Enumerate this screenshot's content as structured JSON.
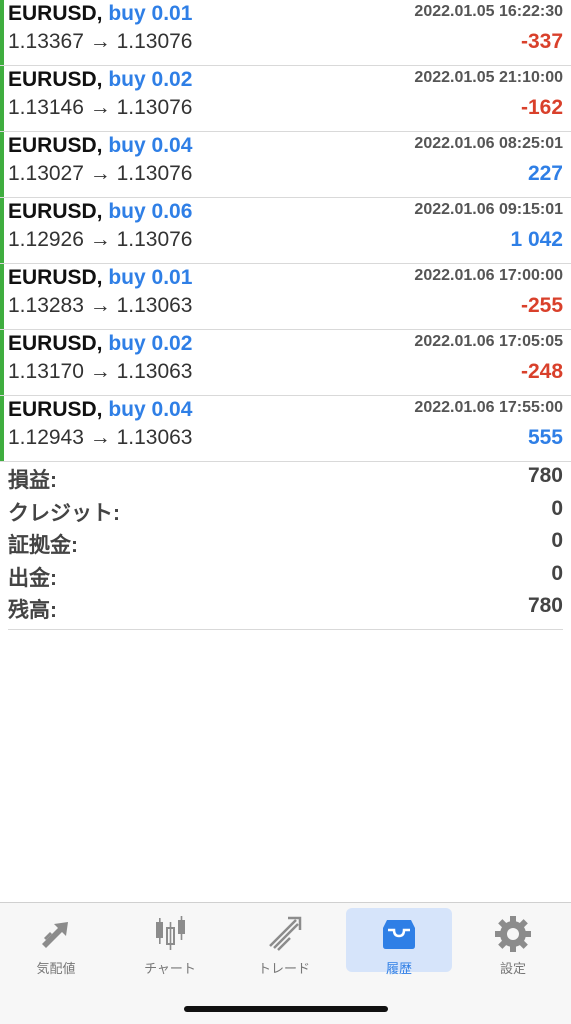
{
  "deals": [
    {
      "symbol": "EURUSD,",
      "type": "buy 0.01",
      "time": "2022.01.05 16:22:30",
      "prices": "1.13367 → 1.13076",
      "profit": "-337",
      "sign": "neg"
    },
    {
      "symbol": "EURUSD,",
      "type": "buy 0.02",
      "time": "2022.01.05 21:10:00",
      "prices": "1.13146 → 1.13076",
      "profit": "-162",
      "sign": "neg"
    },
    {
      "symbol": "EURUSD,",
      "type": "buy 0.04",
      "time": "2022.01.06 08:25:01",
      "prices": "1.13027 → 1.13076",
      "profit": "227",
      "sign": "pos"
    },
    {
      "symbol": "EURUSD,",
      "type": "buy 0.06",
      "time": "2022.01.06 09:15:01",
      "prices": "1.12926 → 1.13076",
      "profit": "1 042",
      "sign": "pos"
    },
    {
      "symbol": "EURUSD,",
      "type": "buy 0.01",
      "time": "2022.01.06 17:00:00",
      "prices": "1.13283 → 1.13063",
      "profit": "-255",
      "sign": "neg"
    },
    {
      "symbol": "EURUSD,",
      "type": "buy 0.02",
      "time": "2022.01.06 17:05:05",
      "prices": "1.13170 → 1.13063",
      "profit": "-248",
      "sign": "neg"
    },
    {
      "symbol": "EURUSD,",
      "type": "buy 0.04",
      "time": "2022.01.06 17:55:00",
      "prices": "1.12943 → 1.13063",
      "profit": "555",
      "sign": "pos"
    }
  ],
  "summary": {
    "profit_label": "損益:",
    "profit_value": "780",
    "credit_label": "クレジット:",
    "credit_value": "0",
    "margin_label": "証拠金:",
    "margin_value": "0",
    "withdrawal_label": "出金:",
    "withdrawal_value": "0",
    "balance_label": "残高:",
    "balance_value": "780"
  },
  "tabs": {
    "quotes": "気配値",
    "chart": "チャート",
    "trade": "トレード",
    "history": "履歴",
    "settings": "設定"
  },
  "colors": {
    "accent": "#2f7fe6",
    "loss": "#d9402b",
    "buy_bar": "#3fae3f",
    "active_tab_bg": "#d6e4fa"
  },
  "icons": {
    "quotes": "diagonal-arrows-icon",
    "chart": "candlestick-icon",
    "trade": "trend-up-icon",
    "history": "inbox-tray-icon",
    "settings": "gear-icon"
  }
}
